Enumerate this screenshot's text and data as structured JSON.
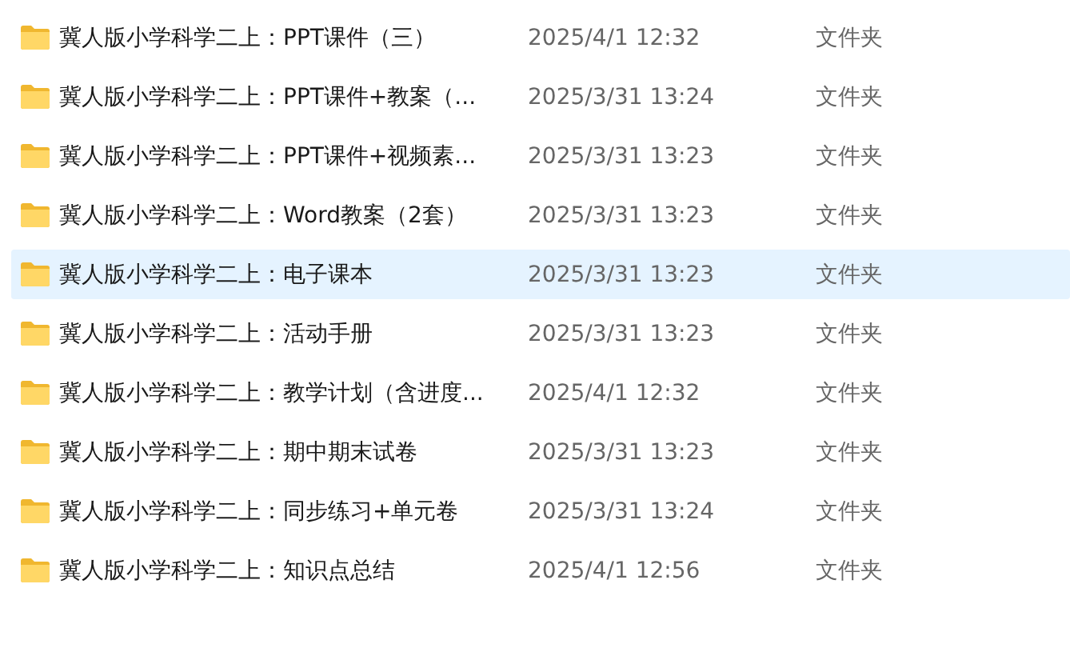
{
  "files": [
    {
      "name": "冀人版小学科学二上：PPT课件（三）",
      "modified": "2025/4/1 12:32",
      "type": "文件夹",
      "selected": false
    },
    {
      "name": "冀人版小学科学二上：PPT课件+教案（...",
      "modified": "2025/3/31 13:24",
      "type": "文件夹",
      "selected": false
    },
    {
      "name": "冀人版小学科学二上：PPT课件+视频素...",
      "modified": "2025/3/31 13:23",
      "type": "文件夹",
      "selected": false
    },
    {
      "name": "冀人版小学科学二上：Word教案（2套）",
      "modified": "2025/3/31 13:23",
      "type": "文件夹",
      "selected": false
    },
    {
      "name": "冀人版小学科学二上：电子课本",
      "modified": "2025/3/31 13:23",
      "type": "文件夹",
      "selected": true
    },
    {
      "name": "冀人版小学科学二上：活动手册",
      "modified": "2025/3/31 13:23",
      "type": "文件夹",
      "selected": false
    },
    {
      "name": "冀人版小学科学二上：教学计划（含进度...",
      "modified": "2025/4/1 12:32",
      "type": "文件夹",
      "selected": false
    },
    {
      "name": "冀人版小学科学二上：期中期末试卷",
      "modified": "2025/3/31 13:23",
      "type": "文件夹",
      "selected": false
    },
    {
      "name": "冀人版小学科学二上：同步练习+单元卷",
      "modified": "2025/3/31 13:24",
      "type": "文件夹",
      "selected": false
    },
    {
      "name": "冀人版小学科学二上：知识点总结",
      "modified": "2025/4/1 12:56",
      "type": "文件夹",
      "selected": false
    }
  ]
}
